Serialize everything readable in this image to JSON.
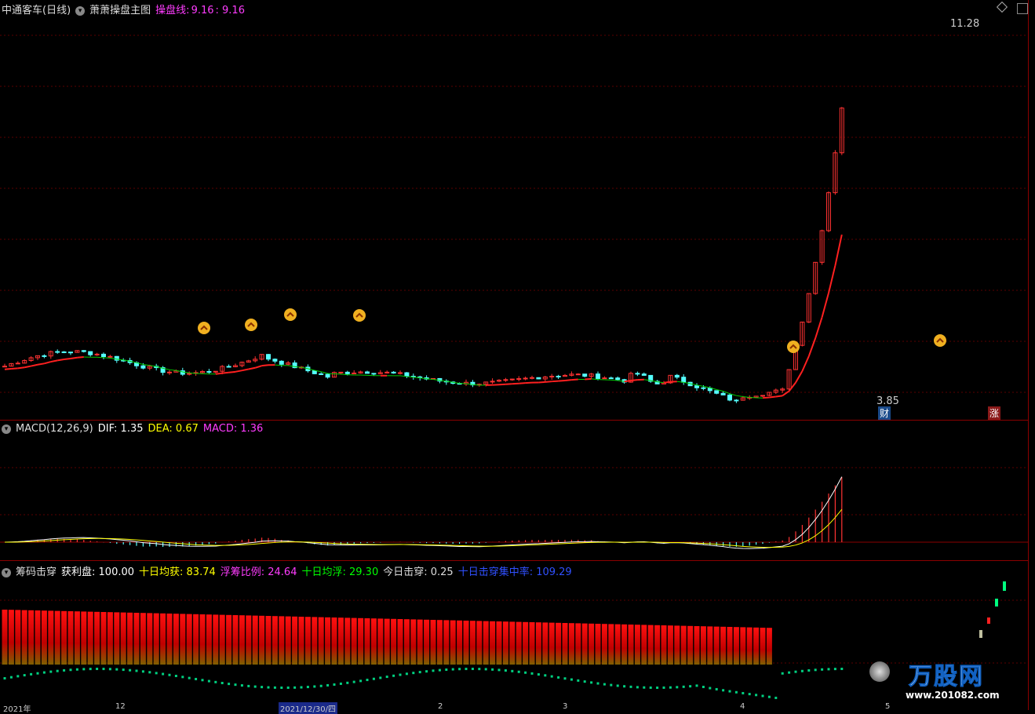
{
  "main": {
    "stock": "中通客车(日线)",
    "indicator": "萧萧操盘主图",
    "line_label": "操盘线:",
    "line_value": "9.16",
    "line_value2": ": 9.16",
    "high_label": "11.28",
    "low_label": "3.85",
    "badge_cai": "财",
    "badge_zhang": "涨"
  },
  "macd": {
    "title": "MACD(12,26,9)",
    "dif": "DIF: 1.35",
    "dea": "DEA: 0.67",
    "macd": "MACD: 1.36"
  },
  "chip": {
    "title": "筹码击穿",
    "profit": "获利盘: 100.00",
    "ten_profit": "十日均获: 83.74",
    "float_ratio": "浮筹比例: 24.64",
    "ten_float": "十日均浮: 29.30",
    "today": "今日击穿: 0.25",
    "ten_conc": "十日击穿集中率: 109.29"
  },
  "axis": {
    "labels": [
      "2021年",
      "12",
      "2021/12/30/四",
      "2",
      "3",
      "4",
      "5"
    ]
  },
  "watermark": {
    "brand": "万股网",
    "url": "www.201082.com"
  },
  "colors": {
    "up": "#ff3232",
    "down": "#54ffff",
    "line_up": "#ff2020",
    "line_down": "#00cc00",
    "dif": "#ffffff",
    "dea": "#ffff00",
    "macd": "#ff00ff"
  }
}
